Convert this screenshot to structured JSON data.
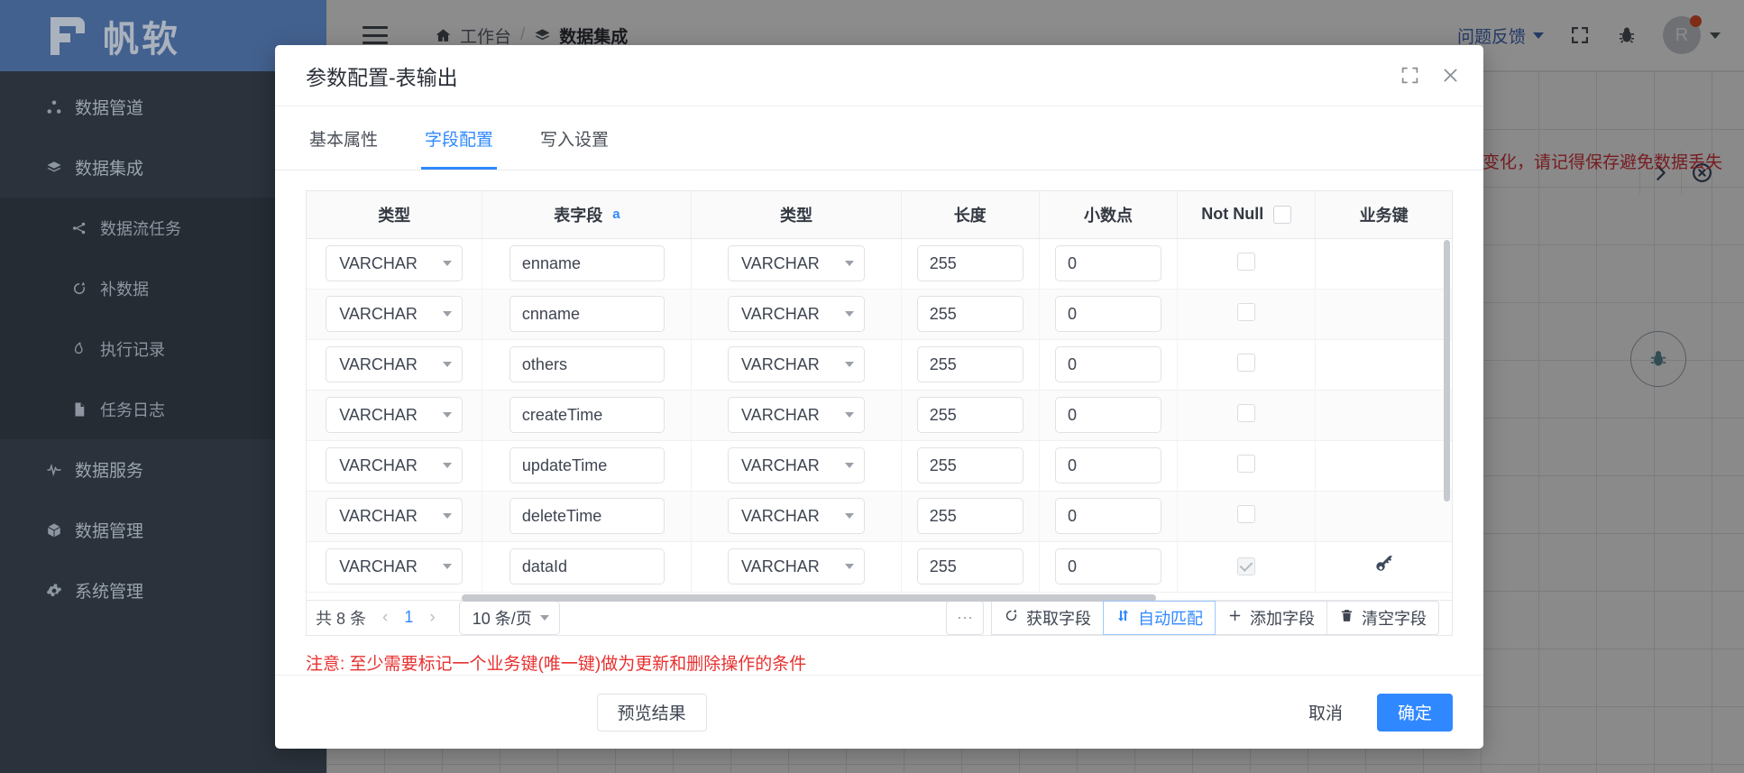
{
  "sidebar": {
    "brand": "帆软",
    "items": [
      {
        "label": "数据管道",
        "icon": "pipeline-icon"
      },
      {
        "label": "数据集成",
        "icon": "layers-icon"
      }
    ],
    "sub_items": [
      {
        "label": "数据流任务",
        "icon": "dataflow-icon"
      },
      {
        "label": "补数据",
        "icon": "refresh-data-icon"
      },
      {
        "label": "执行记录",
        "icon": "record-icon"
      },
      {
        "label": "任务日志",
        "icon": "log-file-icon"
      }
    ],
    "items_after": [
      {
        "label": "数据服务",
        "icon": "pulse-icon"
      },
      {
        "label": "数据管理",
        "icon": "box-icon"
      },
      {
        "label": "系统管理",
        "icon": "gear-icon"
      }
    ]
  },
  "header": {
    "breadcrumb_home": "工作台",
    "breadcrumb_current": "数据集成",
    "feedback": "问题反馈",
    "avatar_initial": "R"
  },
  "canvas": {
    "tip": "变化，请记得保存避免数据丢失"
  },
  "modal": {
    "title": "参数配置-表输出",
    "tabs": [
      {
        "label": "基本属性",
        "active": false
      },
      {
        "label": "字段配置",
        "active": true
      },
      {
        "label": "写入设置",
        "active": false
      }
    ],
    "table": {
      "columns": [
        "类型",
        "表字段",
        "类型",
        "长度",
        "小数点",
        "Not Null",
        "业务键"
      ],
      "sort_indicator": "a",
      "rows": [
        {
          "src_type": "VARCHAR",
          "field": "enname",
          "type": "VARCHAR",
          "length": "255",
          "scale": "0",
          "not_null": false,
          "biz_key": false
        },
        {
          "src_type": "VARCHAR",
          "field": "cnname",
          "type": "VARCHAR",
          "length": "255",
          "scale": "0",
          "not_null": false,
          "biz_key": false
        },
        {
          "src_type": "VARCHAR",
          "field": "others",
          "type": "VARCHAR",
          "length": "255",
          "scale": "0",
          "not_null": false,
          "biz_key": false
        },
        {
          "src_type": "VARCHAR",
          "field": "createTime",
          "type": "VARCHAR",
          "length": "255",
          "scale": "0",
          "not_null": false,
          "biz_key": false
        },
        {
          "src_type": "VARCHAR",
          "field": "updateTime",
          "type": "VARCHAR",
          "length": "255",
          "scale": "0",
          "not_null": false,
          "biz_key": false
        },
        {
          "src_type": "VARCHAR",
          "field": "deleteTime",
          "type": "VARCHAR",
          "length": "255",
          "scale": "0",
          "not_null": false,
          "biz_key": false
        },
        {
          "src_type": "VARCHAR",
          "field": "dataId",
          "type": "VARCHAR",
          "length": "255",
          "scale": "0",
          "not_null": true,
          "biz_key": true
        }
      ]
    },
    "pagination": {
      "total": "共 8 条",
      "prev": "‹",
      "page": "1",
      "next": "›",
      "page_size": "10 条/页"
    },
    "table_buttons": [
      {
        "label": "···",
        "icon": "more-icon",
        "active": false
      },
      {
        "label": "获取字段",
        "icon": "refresh-icon",
        "active": false
      },
      {
        "label": "自动匹配",
        "icon": "swap-icon",
        "active": true
      },
      {
        "label": "添加字段",
        "icon": "plus-icon",
        "active": false
      },
      {
        "label": "清空字段",
        "icon": "trash-icon",
        "active": false
      }
    ],
    "notice": "注意: 至少需要标记一个业务键(唯一键)做为更新和删除操作的条件",
    "footer": {
      "preview": "预览结果",
      "cancel": "取消",
      "confirm": "确定"
    }
  },
  "colors": {
    "accent": "#2f88ff",
    "brand_header": "#43618f",
    "sidebar": "#2b323b",
    "danger": "#e8302f"
  }
}
